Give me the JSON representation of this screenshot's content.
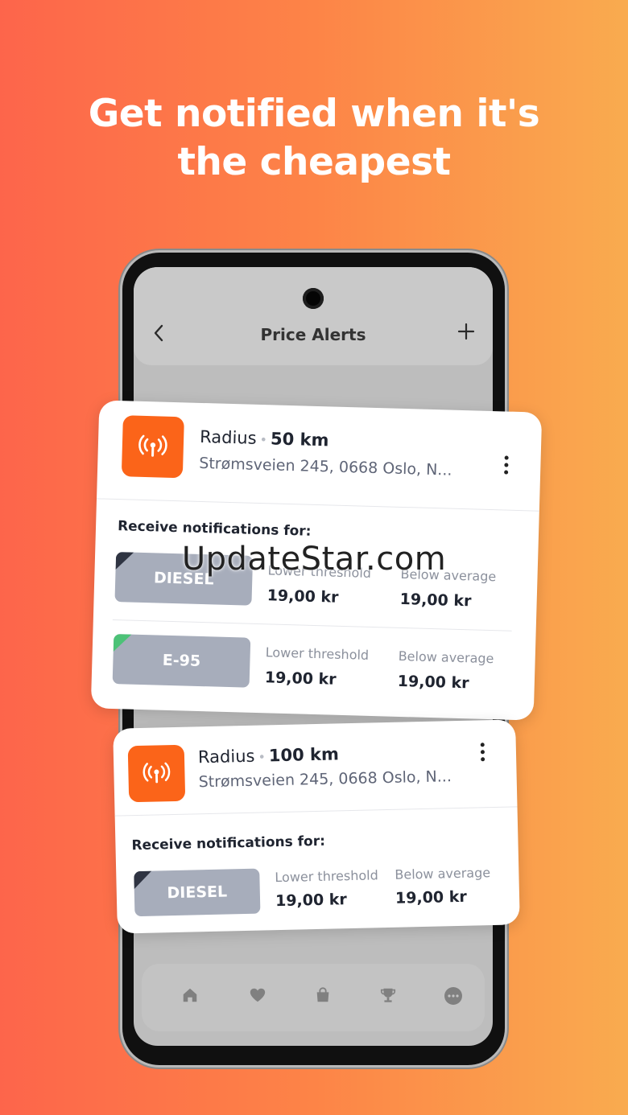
{
  "headline": {
    "line1": "Get notified when it's",
    "line2": "the cheapest"
  },
  "appbar": {
    "title": "Price Alerts",
    "back_icon": "chevron-left-icon",
    "add_icon": "plus-icon"
  },
  "alerts": [
    {
      "radius_label": "Radius",
      "radius_value": "50 km",
      "address": "Strømsveien 245, 0668 Oslo, N...",
      "receive_label": "Receive notifications for:",
      "fuels": [
        {
          "name": "DIESEL",
          "corner_color": "#2f3442",
          "lower_label": "Lower threshold",
          "lower_value": "19,00 kr",
          "below_label": "Below average",
          "below_value": "19,00 kr"
        },
        {
          "name": "E-95",
          "corner_color": "#4cc277",
          "lower_label": "Lower threshold",
          "lower_value": "19,00 kr",
          "below_label": "Below average",
          "below_value": "19,00 kr"
        }
      ]
    },
    {
      "radius_label": "Radius",
      "radius_value": "100 km",
      "address": "Strømsveien 245, 0668 Oslo, N...",
      "receive_label": "Receive notifications for:",
      "fuels": [
        {
          "name": "DIESEL",
          "corner_color": "#2f3442",
          "lower_label": "Lower threshold",
          "lower_value": "19,00 kr",
          "below_label": "Below average",
          "below_value": "19,00 kr"
        }
      ]
    }
  ],
  "bottom_nav": [
    "home-icon",
    "heart-icon",
    "shopping-bag-icon",
    "trophy-icon",
    "more-horizontal-icon"
  ],
  "watermark": "UpdateStar.com",
  "colors": {
    "accent": "#fb6419",
    "background_start": "#fd654b",
    "background_end": "#f9ab4f"
  }
}
